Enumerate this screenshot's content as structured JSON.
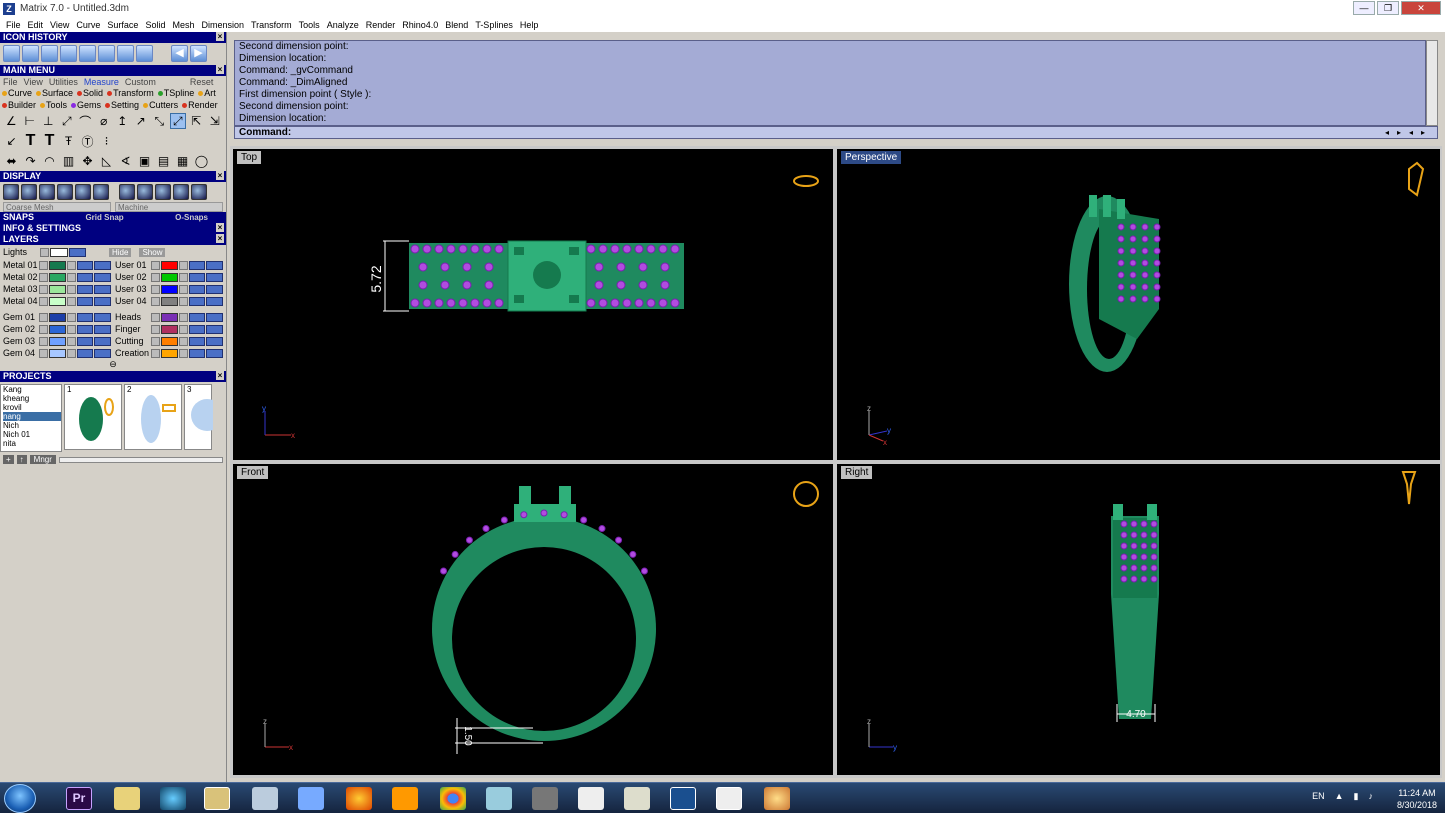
{
  "window": {
    "title": "Matrix 7.0 - Untitled.3dm",
    "app_icon": "Z"
  },
  "menu": [
    "File",
    "Edit",
    "View",
    "Curve",
    "Surface",
    "Solid",
    "Mesh",
    "Dimension",
    "Transform",
    "Tools",
    "Analyze",
    "Render",
    "Rhino4.0",
    "Blend",
    "T-Splines",
    "Help"
  ],
  "sections": {
    "icon_history": "ICON HISTORY",
    "main_menu": "MAIN MENU",
    "display": "DISPLAY",
    "snaps": "SNAPS",
    "info": "INFO & SETTINGS",
    "layers": "LAYERS",
    "projects": "PROJECTS"
  },
  "main_menu_tabs": [
    "File",
    "View",
    "Utilities",
    "Measure",
    "Custom",
    "Reset"
  ],
  "categories_row1": [
    {
      "label": "Curve",
      "color": "#e8a317"
    },
    {
      "label": "Surface",
      "color": "#e8a317"
    },
    {
      "label": "Solid",
      "color": "#d9331f"
    },
    {
      "label": "Transform",
      "color": "#d9331f"
    },
    {
      "label": "TSpline",
      "color": "#2aa02a"
    },
    {
      "label": "Art",
      "color": "#e8a317"
    }
  ],
  "categories_row2": [
    {
      "label": "Builder",
      "color": "#d9331f"
    },
    {
      "label": "Tools",
      "color": "#e8a317"
    },
    {
      "label": "Gems",
      "color": "#8a2be2"
    },
    {
      "label": "Setting",
      "color": "#d9331f"
    },
    {
      "label": "Cutters",
      "color": "#e8a317"
    },
    {
      "label": "Render",
      "color": "#d9331f"
    }
  ],
  "display": {
    "mesh": "Coarse Mesh",
    "material": "Machine"
  },
  "snaps": {
    "grid": "Grid Snap",
    "osnaps": "O-Snaps"
  },
  "layers": {
    "lights": "Lights",
    "hide": "Hide",
    "show": "Show",
    "left": [
      {
        "name": "Metal 01",
        "color": "#157a4e"
      },
      {
        "name": "Metal 02",
        "color": "#2aa862"
      },
      {
        "name": "Metal 03",
        "color": "#9be79b"
      },
      {
        "name": "Metal 04",
        "color": "#c8ffc8"
      },
      {
        "name": "Gem 01",
        "color": "#1d3fa8"
      },
      {
        "name": "Gem 02",
        "color": "#2b66d6"
      },
      {
        "name": "Gem 03",
        "color": "#6fa0ff"
      },
      {
        "name": "Gem 04",
        "color": "#a7c7ff"
      }
    ],
    "right": [
      {
        "name": "User 01",
        "color": "#ff0000"
      },
      {
        "name": "User 02",
        "color": "#00c800"
      },
      {
        "name": "User 03",
        "color": "#0000ff"
      },
      {
        "name": "User 04",
        "color": "#808080"
      },
      {
        "name": "Heads",
        "color": "#7a2fb5"
      },
      {
        "name": "Finger",
        "color": "#b03060"
      },
      {
        "name": "Cutting",
        "color": "#ff7f00"
      },
      {
        "name": "Creation",
        "color": "#ffa500"
      }
    ]
  },
  "projects": {
    "list": [
      "Kang",
      "kheang",
      "krovil",
      "nang",
      "Nich",
      "Nich 01",
      "nita"
    ],
    "selected": "nang",
    "thumbs": [
      "1",
      "2",
      "3"
    ],
    "manager": "Mngr"
  },
  "command_history": [
    "Second dimension point:",
    "Dimension location:",
    "Command: _gvCommand",
    "Command: _DimAligned",
    "First dimension point ( Style ):",
    "Second dimension point:",
    "Dimension location:"
  ],
  "command_prompt": "Command:",
  "viewports": {
    "top": {
      "label": "Top",
      "dimension": "5.72"
    },
    "perspective": {
      "label": "Perspective"
    },
    "front": {
      "label": "Front",
      "dimension": "1.50"
    },
    "right": {
      "label": "Right",
      "dimension": "4.70"
    }
  },
  "axes": {
    "x": "x",
    "y": "y",
    "z": "z"
  },
  "colors": {
    "metal": "#1f8a5f",
    "metal_light": "#2fb07a",
    "gem": "#7a1fb0",
    "gem_light": "#b14ce0",
    "outline": "#e8a317"
  },
  "taskbar": {
    "lang": "EN",
    "time": "11:24 AM",
    "date": "8/30/2018",
    "premiere_label": "Pr"
  }
}
